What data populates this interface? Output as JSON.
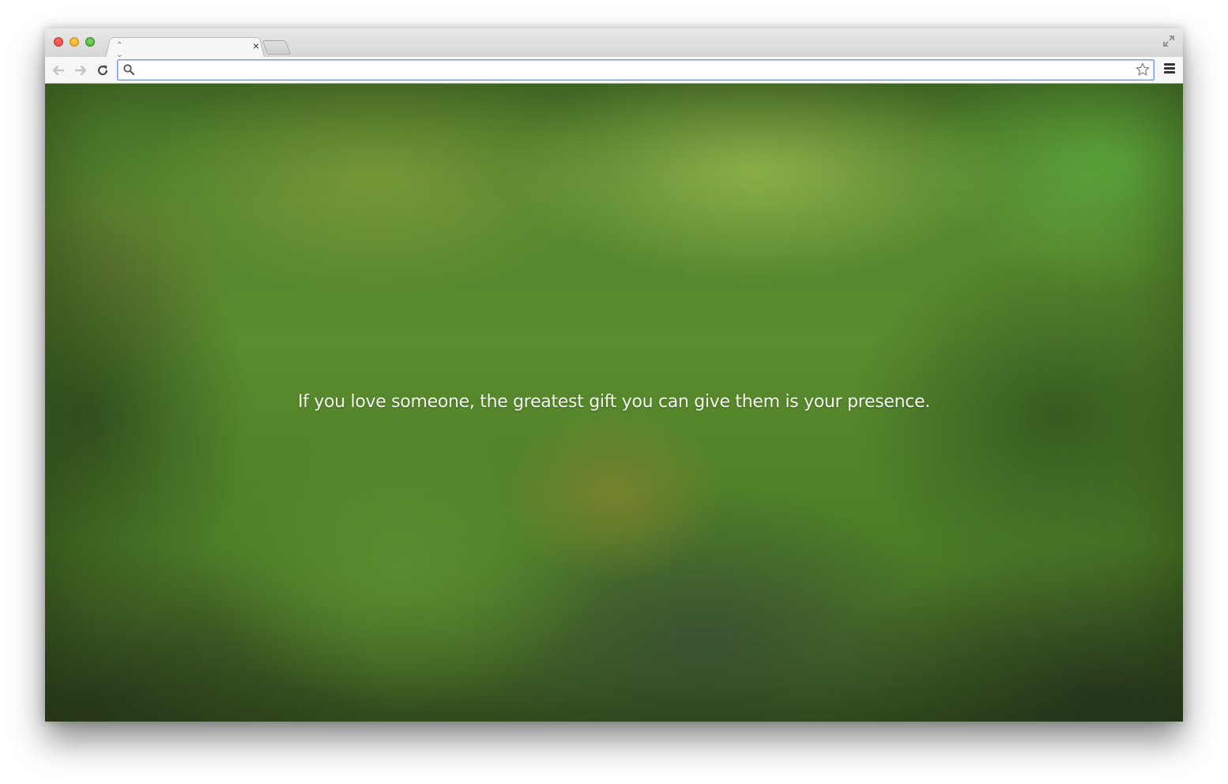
{
  "browser": {
    "tab": {
      "title": "",
      "close_glyph": "×",
      "loading_icon": "spinner-icon"
    },
    "toolbar": {
      "back_icon": "back-arrow-icon",
      "forward_icon": "forward-arrow-icon",
      "reload_icon": "reload-icon",
      "menu_icon": "hamburger-menu-icon",
      "star_icon": "bookmark-star-icon"
    },
    "omnibox": {
      "value": "",
      "search_icon": "search-icon"
    }
  },
  "page": {
    "quote": "If you love someone, the greatest gift you can give them is your presence."
  },
  "colors": {
    "background_green": "#5b8c2e",
    "quote_text": "#f4f7ee",
    "omnibox_focus": "#7c9ed6"
  }
}
